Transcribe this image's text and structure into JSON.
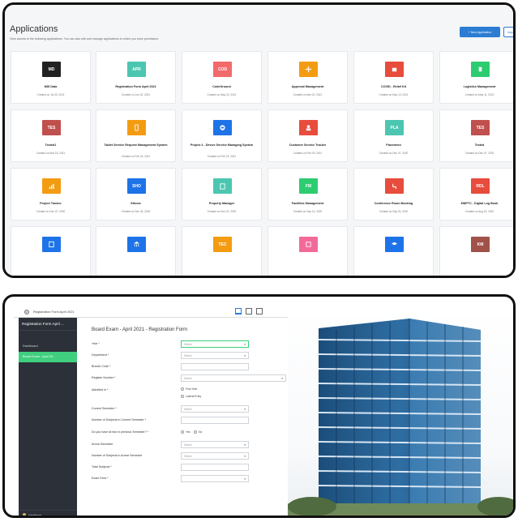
{
  "apps": {
    "title": "Applications",
    "subtitle": "View access to the following applications. You can also edit and manage applications to which you have permission.",
    "new_button": "+ New Application",
    "import_button": "Import",
    "cards": [
      {
        "name": "MIS Data",
        "date": "Created on Jul 30, 2021",
        "abbr": "MD",
        "color": "#222222"
      },
      {
        "name": "Registration Form April 2021",
        "date": "Created on Jun 03, 2021",
        "abbr": "APR",
        "color": "#4cc6b0"
      },
      {
        "name": "CodeGround",
        "date": "Created on May 22, 2021",
        "abbr": "COD",
        "color": "#f26a6a"
      },
      {
        "name": "Approval Management",
        "date": "Created on Mar 22, 2021",
        "abbr": "",
        "icon": "approval-icon",
        "color": "#f39c12"
      },
      {
        "name": "COVID - Relief Kit",
        "date": "Created on May 13, 2021",
        "abbr": "",
        "icon": "kit-icon",
        "color": "#e74c3c"
      },
      {
        "name": "Logistics Management",
        "date": "Created on May 11, 2021",
        "abbr": "",
        "icon": "logistics-icon",
        "color": "#2ecc71"
      },
      {
        "name": "Tested1",
        "date": "Created on Mar 18, 2021",
        "abbr": "TES",
        "color": "#c0504d"
      },
      {
        "name": "Tablet Service Request Management System",
        "date": "Created on Feb 26, 2021",
        "abbr": "",
        "icon": "tablet-icon",
        "color": "#f39c12"
      },
      {
        "name": "Project 4 - Device Service Managing System",
        "date": "Created on Feb 23, 2021",
        "abbr": "",
        "icon": "device-icon",
        "color": "#1e73e8"
      },
      {
        "name": "Customer Service Tracker",
        "date": "Created on Feb 09, 2021",
        "abbr": "",
        "icon": "customer-icon",
        "color": "#e74c3c"
      },
      {
        "name": "Placement",
        "date": "Created on Dec 07, 2020",
        "abbr": "PLA",
        "color": "#4cc6b0"
      },
      {
        "name": "Tested",
        "date": "Created on Dec 07, 2020",
        "abbr": "TES",
        "color": "#c0504d"
      },
      {
        "name": "Project Tracker",
        "date": "Created on Dec 07, 2020",
        "abbr": "",
        "icon": "tracker-icon",
        "color": "#f39c12"
      },
      {
        "name": "SHome",
        "date": "Created on Dec 04, 2020",
        "abbr": "SHO",
        "color": "#1e73e8"
      },
      {
        "name": "Property Manager",
        "date": "Created on Nov 22, 2020",
        "abbr": "",
        "icon": "property-icon",
        "color": "#4cc6b0"
      },
      {
        "name": "Facilities Management",
        "date": "Created on Sep 14, 2020",
        "abbr": "FM",
        "color": "#2ecc71"
      },
      {
        "name": "Conference Room Booking",
        "date": "Created on Sep 03, 2020",
        "abbr": "",
        "icon": "conference-icon",
        "color": "#e74c3c"
      },
      {
        "name": "MNPTC - Digital Log Book",
        "date": "Created on Aug 20, 2020",
        "abbr": "RDL",
        "color": "#e74c3c"
      },
      {
        "name": "",
        "date": "",
        "abbr": "",
        "icon": "book-icon",
        "color": "#1e73e8"
      },
      {
        "name": "",
        "date": "",
        "abbr": "",
        "icon": "bank-icon",
        "color": "#1e73e8"
      },
      {
        "name": "",
        "date": "",
        "abbr": "TEC",
        "color": "#f39c12"
      },
      {
        "name": "",
        "date": "",
        "abbr": "",
        "icon": "calendar-icon",
        "color": "#f26a9a"
      },
      {
        "name": "",
        "date": "",
        "abbr": "",
        "icon": "graduation-icon",
        "color": "#1e73e8"
      },
      {
        "name": "",
        "date": "",
        "abbr": "KM",
        "color": "#a0524a"
      }
    ]
  },
  "form": {
    "tab_label": "Registration Form April 2021",
    "app_header": "Registration Form April ...",
    "nav_dashboard": "Dashboard",
    "nav_active": "Board Exam - April 20...",
    "footer_user": "Intellimine",
    "title": "Board Exam - April 2021 - Registration Form",
    "fields": [
      {
        "label": "Year *",
        "value": "Select",
        "kind": "select",
        "style": "green"
      },
      {
        "label": "Department *",
        "value": "Select",
        "kind": "select"
      },
      {
        "label": "Branch Code *",
        "value": "",
        "kind": "text"
      },
      {
        "label": "Register Number *",
        "value": "Select",
        "kind": "select-wide"
      },
      {
        "label": "Admitted in *",
        "value": "",
        "kind": "radio",
        "options": [
          "First Year",
          "Lateral Entry"
        ]
      },
      {
        "label": "Current Semester *",
        "value": "Select",
        "kind": "select"
      },
      {
        "label": "Number of Subjects in Current Semester *",
        "value": "",
        "kind": "text"
      },
      {
        "label": "Do you have Arrear in previous Semester? *",
        "value": "",
        "kind": "radio-inline",
        "options": [
          "Yes",
          "No"
        ]
      },
      {
        "label": "Arrear Semester",
        "value": "Select",
        "kind": "select"
      },
      {
        "label": "Number of Subjects in Arrear Semester",
        "value": "Select",
        "kind": "select"
      },
      {
        "label": "Total Subjects *",
        "value": "",
        "kind": "text"
      },
      {
        "label": "Exam Fees *",
        "value": "",
        "kind": "stepper"
      }
    ]
  }
}
